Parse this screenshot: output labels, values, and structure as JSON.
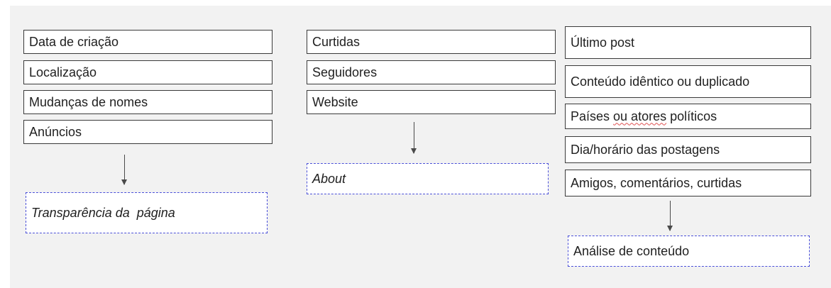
{
  "column_left": {
    "items": [
      "Data de criação",
      "Localização",
      "Mudanças de nomes",
      "Anúncios"
    ],
    "result": "Transparência da  página"
  },
  "column_middle": {
    "items": [
      "Curtidas",
      "Seguidores",
      "Website"
    ],
    "result": "About"
  },
  "column_right": {
    "items": [
      "Último post",
      "Conteúdo idêntico ou duplicado",
      "Dia/horário das postagens",
      "Amigos, comentários, curtidas"
    ],
    "item_countries_part1": "Países ",
    "item_countries_part2": "ou atores",
    "item_countries_part3": " políticos",
    "result": "Análise de conteúdo"
  },
  "colors": {
    "background": "#f2f2f2",
    "box_border": "#3a3a3a",
    "dashed_border": "#4a4fd8",
    "spellcheck": "#e05050"
  }
}
